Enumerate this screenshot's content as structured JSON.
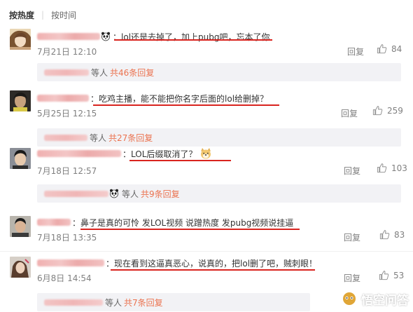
{
  "sort": {
    "hot": "按热度",
    "time": "按时间"
  },
  "reply_label": "回复",
  "comments": [
    {
      "text": "lol还是去掉了，加上pubg吧，忘本了你",
      "date": "7月21日 12:10",
      "likes": "84",
      "replies": {
        "etal": "等人",
        "count": "共46条回复"
      },
      "emoji": "panda-emoji"
    },
    {
      "text": "吃鸡主播，能不能把你名字后面的lol给删掉？",
      "date": "5月25日 12:15",
      "likes": "259",
      "replies": {
        "etal": "等人",
        "count": "共27条回复"
      }
    },
    {
      "text": "LOL后缀取消了？",
      "date": "7月18日 12:57",
      "likes": "103",
      "replies": {
        "etal": "等人",
        "count": "共9条回复"
      },
      "emoji": "doge-emoji"
    },
    {
      "text": "鼻子是真的可怜 发LOL视频 说蹭热度 发pubg视频说挂逼",
      "date": "7月18日 13:35",
      "likes": "83"
    },
    {
      "text": "现在看到这逼真恶心，说真的，把lol删了吧，贼刺眼！",
      "date": "6月8日 14:54",
      "likes": "53",
      "replies": {
        "etal": "等人",
        "count": "共7条回复"
      }
    }
  ],
  "watermark": "悟空问答",
  "colors": {
    "underline": "#d9241f",
    "reply_count": "#eb7350",
    "reply_bg": "#f2f2f5",
    "meta": "#808080"
  }
}
